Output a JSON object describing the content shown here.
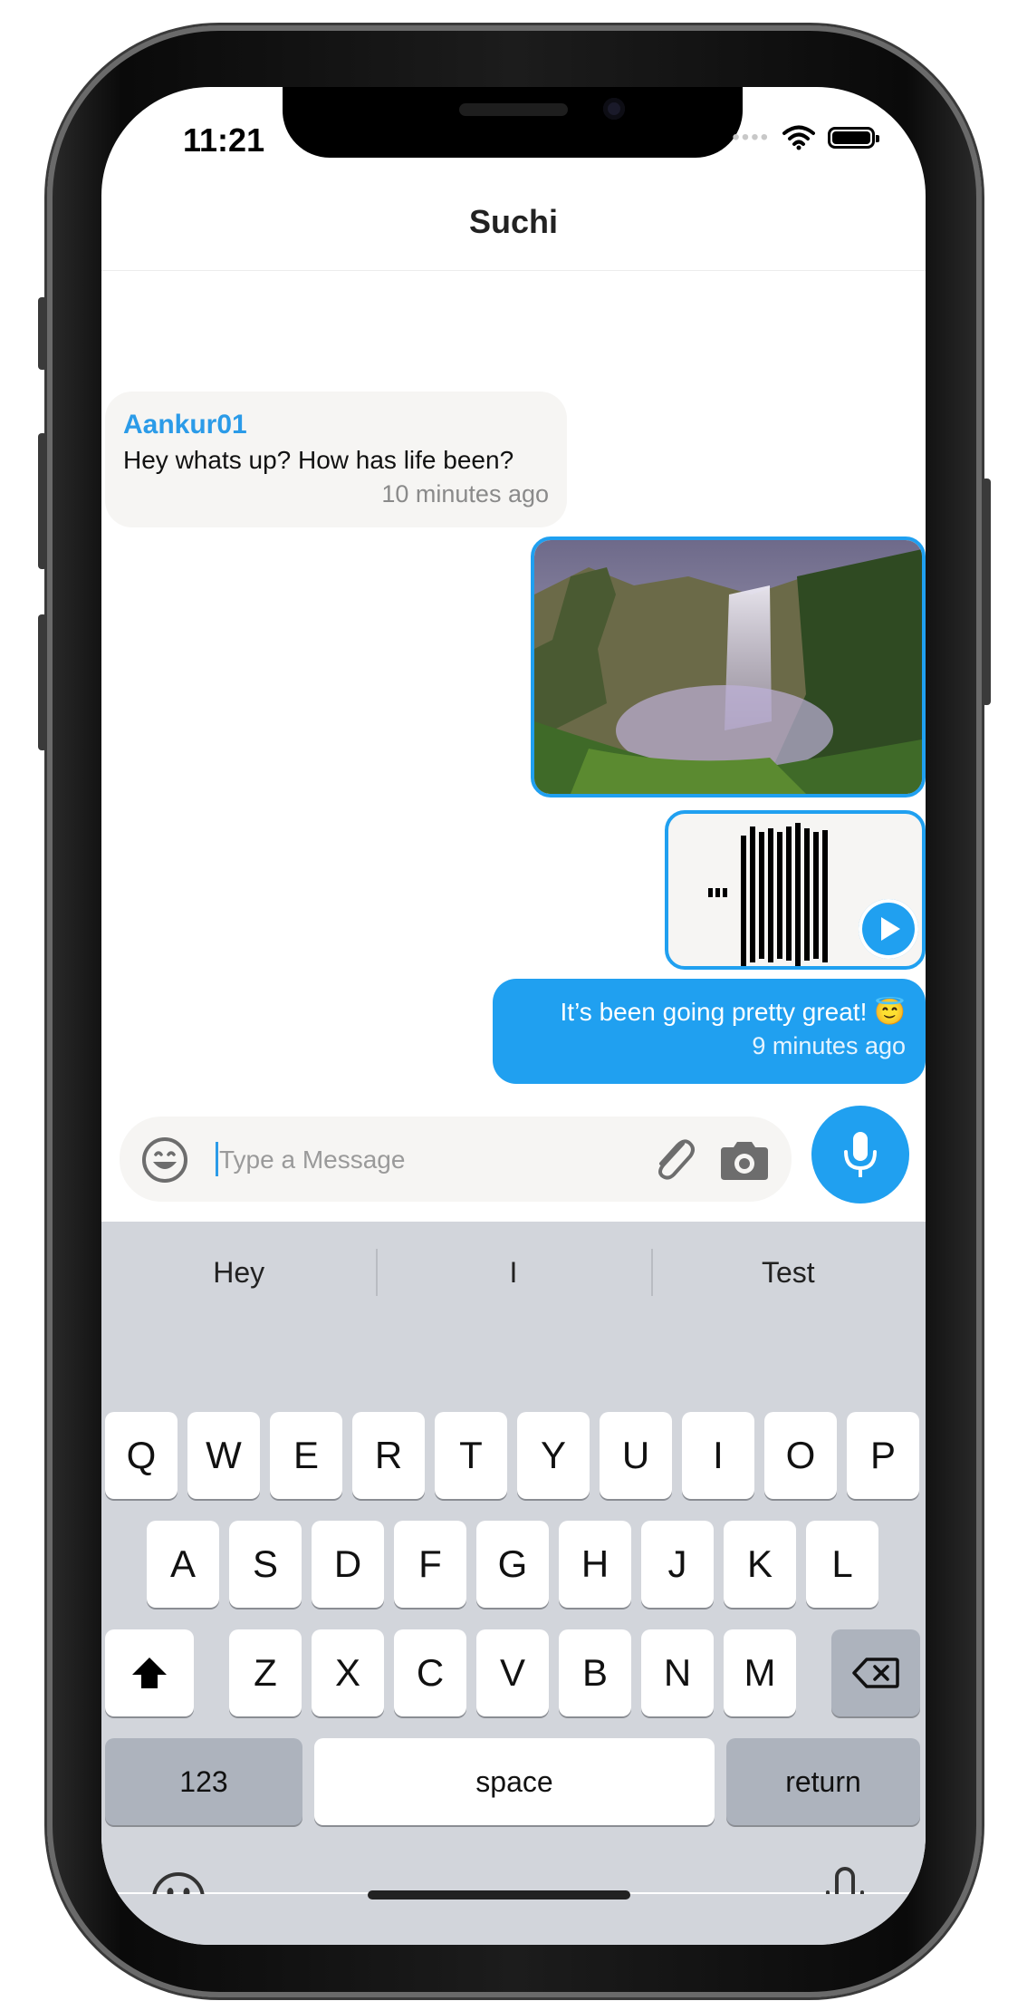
{
  "status_bar": {
    "time": "11:21"
  },
  "chat": {
    "title": "Suchi"
  },
  "messages": {
    "incoming": {
      "sender": "Aankur01",
      "text": "Hey whats up? How has life been?",
      "time": "10 minutes ago"
    },
    "outgoing": {
      "text": "It’s been going pretty great! 😇",
      "time": "9 minutes ago"
    }
  },
  "composer": {
    "placeholder": "Type a Message"
  },
  "keyboard": {
    "suggestions": [
      "Hey",
      "I",
      "Test"
    ],
    "row1": [
      "Q",
      "W",
      "E",
      "R",
      "T",
      "Y",
      "U",
      "I",
      "O",
      "P"
    ],
    "row2": [
      "A",
      "S",
      "D",
      "F",
      "G",
      "H",
      "J",
      "K",
      "L"
    ],
    "row3": [
      "Z",
      "X",
      "C",
      "V",
      "B",
      "N",
      "M"
    ],
    "numbers_label": "123",
    "space_label": "space",
    "return_label": "return"
  },
  "colors": {
    "accent": "#20a0f0",
    "sender_name": "#2b9be8",
    "incoming_bubble": "#f6f5f3",
    "keyboard_bg": "#d2d5db"
  },
  "icons": [
    "emoji-icon",
    "paperclip-icon",
    "camera-icon",
    "microphone-icon",
    "play-icon",
    "shift-icon",
    "backspace-icon",
    "keyboard-emoji-icon",
    "dictation-icon",
    "wifi-icon",
    "battery-icon"
  ]
}
